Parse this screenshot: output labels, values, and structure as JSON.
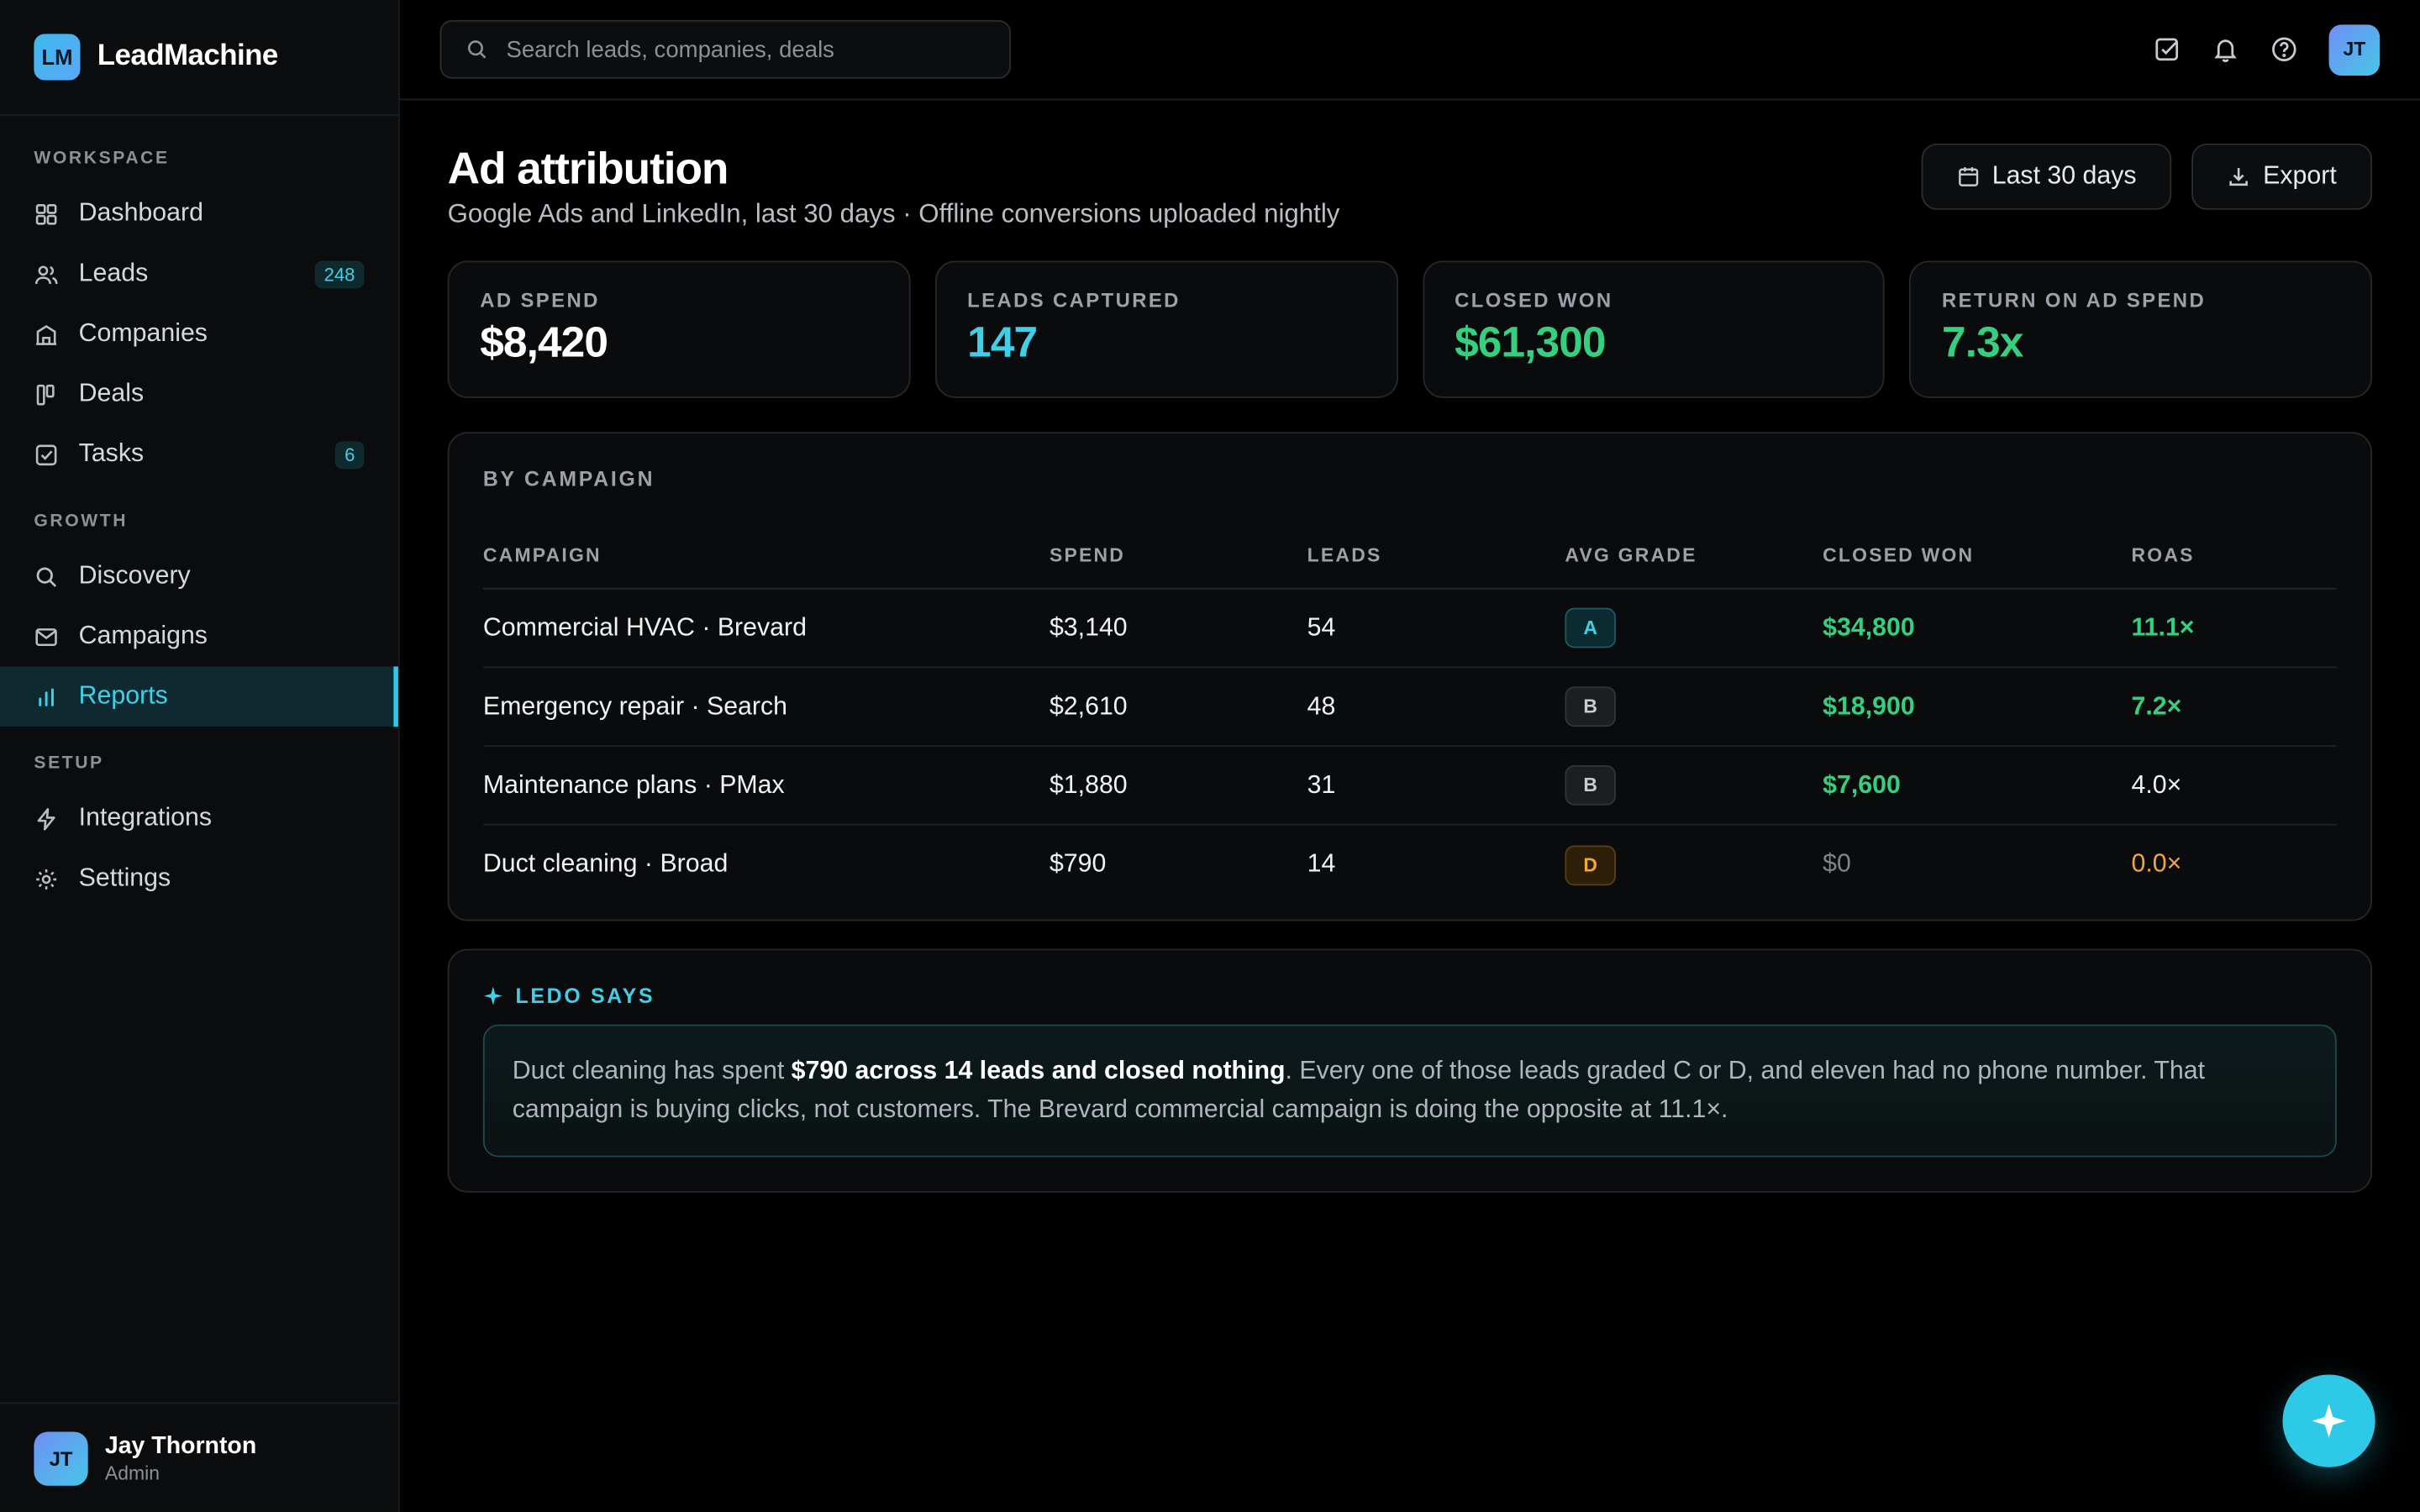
{
  "brand": {
    "logo": "LM",
    "name": "LeadMachine"
  },
  "nav": {
    "workspace_label": "WORKSPACE",
    "growth_label": "GROWTH",
    "setup_label": "SETUP",
    "items": [
      {
        "label": "Dashboard",
        "icon": "grid-icon"
      },
      {
        "label": "Leads",
        "icon": "users-icon",
        "count": "248"
      },
      {
        "label": "Companies",
        "icon": "building-icon"
      },
      {
        "label": "Deals",
        "icon": "kanban-icon"
      },
      {
        "label": "Tasks",
        "icon": "checkbox-icon",
        "count": "6"
      },
      {
        "label": "Discovery",
        "icon": "search-icon"
      },
      {
        "label": "Campaigns",
        "icon": "mail-icon"
      },
      {
        "label": "Reports",
        "icon": "bar-chart-icon",
        "active": true
      },
      {
        "label": "Integrations",
        "icon": "bolt-icon"
      },
      {
        "label": "Settings",
        "icon": "gear-icon"
      }
    ]
  },
  "user": {
    "initials": "JT",
    "name": "Jay Thornton",
    "role": "Admin"
  },
  "search": {
    "placeholder": "Search leads, companies, deals"
  },
  "page": {
    "title": "Ad attribution",
    "subtitle": "Google Ads and LinkedIn, last 30 days · Offline conversions uploaded nightly",
    "range_button": "Last 30 days",
    "export_button": "Export"
  },
  "kpis": [
    {
      "label": "AD SPEND",
      "value": "$8,420",
      "color": "#ffffff"
    },
    {
      "label": "LEADS CAPTURED",
      "value": "147",
      "color": "#3fd0e8"
    },
    {
      "label": "CLOSED WON",
      "value": "$61,300",
      "color": "#35d07f"
    },
    {
      "label": "RETURN ON AD SPEND",
      "value": "7.3x",
      "color": "#35d07f"
    }
  ],
  "campaigns": {
    "title": "BY CAMPAIGN",
    "headers": [
      "CAMPAIGN",
      "SPEND",
      "LEADS",
      "AVG GRADE",
      "CLOSED WON",
      "ROAS"
    ],
    "rows": [
      {
        "campaign": "Commercial HVAC · Brevard",
        "spend": "$3,140",
        "leads": "54",
        "grade": "A",
        "closed_won": "$34,800",
        "roas": "11.1×"
      },
      {
        "campaign": "Emergency repair · Search",
        "spend": "$2,610",
        "leads": "48",
        "grade": "B",
        "closed_won": "$18,900",
        "roas": "7.2×"
      },
      {
        "campaign": "Maintenance plans · PMax",
        "spend": "$1,880",
        "leads": "31",
        "grade": "B",
        "closed_won": "$7,600",
        "roas": "4.0×"
      },
      {
        "campaign": "Duct cleaning · Broad",
        "spend": "$790",
        "leads": "14",
        "grade": "D",
        "closed_won": "$0",
        "roas": "0.0×"
      }
    ]
  },
  "ledo": {
    "title": "LEDO SAYS",
    "text_before": "Duct cleaning has spent ",
    "text_bold": "$790 across 14 leads and closed nothing",
    "text_after": ". Every one of those leads graded C or D, and eleven had no phone number. That campaign is buying clicks, not customers. The Brevard commercial campaign is doing the opposite at 11.1×."
  },
  "colors": {
    "accent": "#2ec9e6",
    "green": "#35d07f",
    "orange": "#f1a83a"
  }
}
